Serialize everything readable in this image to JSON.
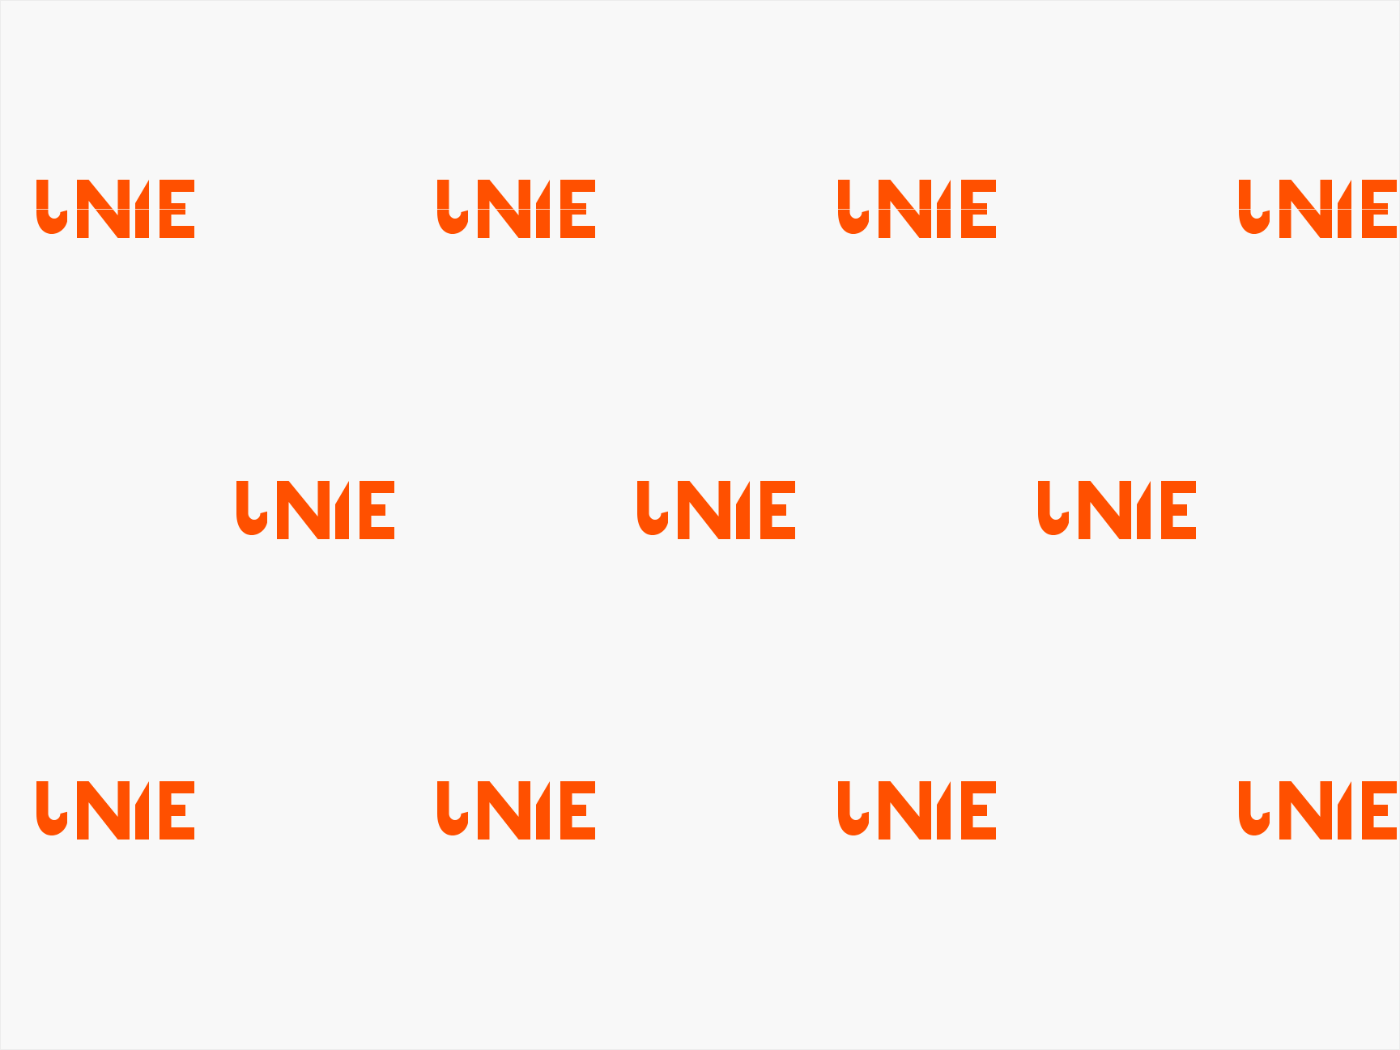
{
  "pattern": {
    "brand_color": "#ff5000",
    "background_color": "#f8f8f8",
    "wordmark": "UNIE",
    "rows": [
      {
        "count": 4,
        "variant": "split"
      },
      {
        "count": 3,
        "variant": "solid"
      },
      {
        "count": 4,
        "variant": "solid"
      }
    ]
  }
}
